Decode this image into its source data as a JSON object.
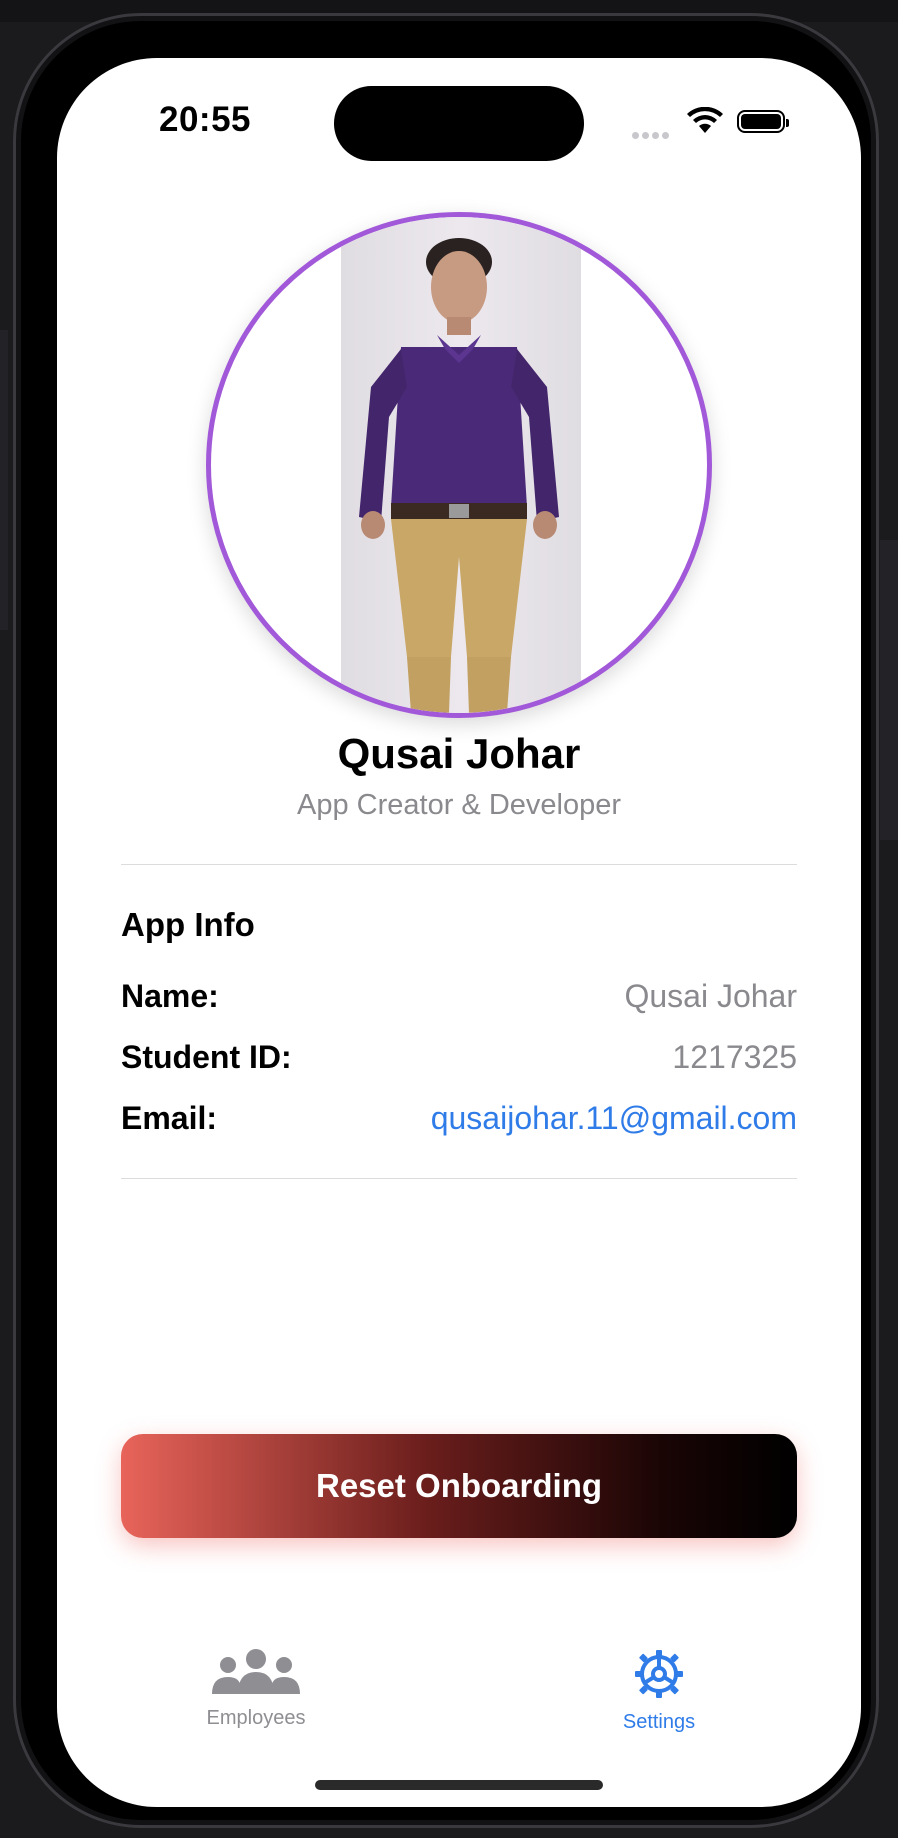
{
  "status": {
    "time": "20:55"
  },
  "profile": {
    "name": "Qusai Johar",
    "role": "App Creator & Developer"
  },
  "app_info": {
    "title": "App Info",
    "rows": [
      {
        "label": "Name:",
        "value": "Qusai Johar"
      },
      {
        "label": "Student ID:",
        "value": "1217325"
      },
      {
        "label": "Email:",
        "value": "qusaijohar.11@gmail.com"
      }
    ]
  },
  "actions": {
    "reset_label": "Reset Onboarding"
  },
  "tabbar": {
    "items": [
      {
        "label": "Employees",
        "icon": "people-icon",
        "selected": false
      },
      {
        "label": "Settings",
        "icon": "gear-icon",
        "selected": true
      }
    ]
  },
  "colors": {
    "accent": "#2f7ce9",
    "avatar_ring": "#a259d9",
    "button_start": "#e8645a",
    "button_end": "#000000",
    "secondary_text": "#8a8a8e"
  }
}
